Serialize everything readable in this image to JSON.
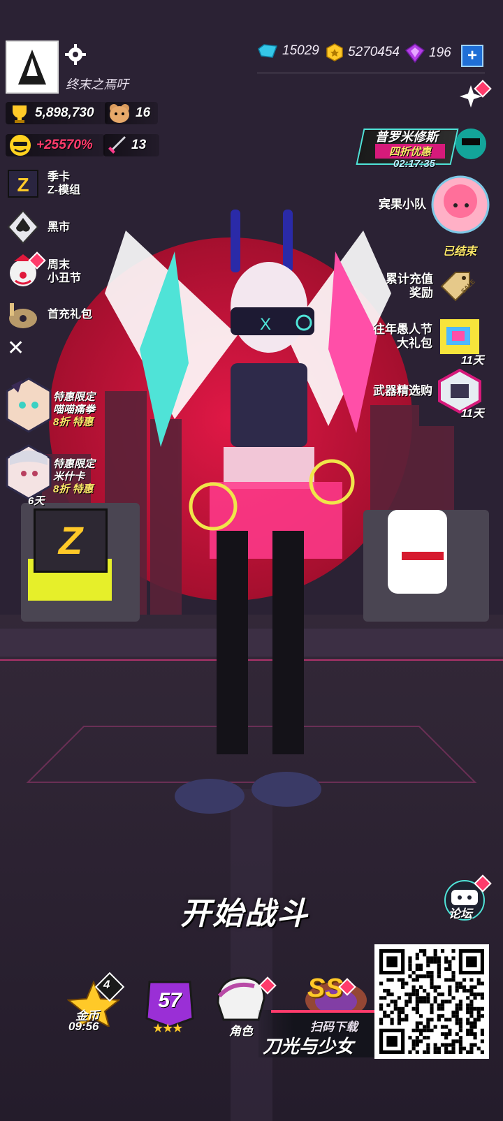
{
  "profile": {
    "name": "终末之焉吁"
  },
  "currency": {
    "gems": "15029",
    "gold": "5270454",
    "crystals": "196"
  },
  "stats": {
    "trophies": "5,898,730",
    "bear": "16",
    "bonus": "+25570%",
    "sword": "13"
  },
  "left_menu": [
    {
      "id": "season-card",
      "line1": "季卡",
      "line2": "Z-模组"
    },
    {
      "id": "black-market",
      "line1": "黑市",
      "line2": ""
    },
    {
      "id": "clown-festival",
      "line1": "周末",
      "line2": "小丑节"
    },
    {
      "id": "first-charge",
      "line1": "首充礼包",
      "line2": ""
    }
  ],
  "offers_left": [
    {
      "id": "offer-1",
      "title": "特惠限定",
      "name": "喵喵痛拳",
      "discount": "8折 特惠",
      "days": ""
    },
    {
      "id": "offer-2",
      "title": "特惠限定",
      "name": "米什卡",
      "discount": "8折 特惠",
      "days": "6天"
    }
  ],
  "right_menu": {
    "promo": {
      "title": "普罗米修斯",
      "subtitle": "四折优惠",
      "timer": "02:17:35"
    },
    "guests": {
      "label": "宾果小队",
      "status": "已结束"
    },
    "recharge": {
      "line1": "累计充值",
      "line2": "奖励",
      "tag": "SALE"
    },
    "fools": {
      "line1": "往年愚人节",
      "line2": "大礼包",
      "days": "11天"
    },
    "weapons": {
      "label": "武器精选购",
      "days": "11天"
    }
  },
  "forum": {
    "label": "论坛"
  },
  "start_button": "开始战斗",
  "bottom": {
    "gold": {
      "label": "金币",
      "timer": "09:56",
      "count": "4"
    },
    "level": {
      "value": "57"
    },
    "role": {
      "label": "角色"
    },
    "rank": {
      "value": "SS"
    }
  },
  "download": {
    "hint": "扫码下载",
    "title": "刀光与少女"
  },
  "colors": {
    "accent_pink": "#ff3b8c",
    "accent_cyan": "#4fe3d7",
    "bg": "#2a2133",
    "sun": "#c8143c"
  }
}
